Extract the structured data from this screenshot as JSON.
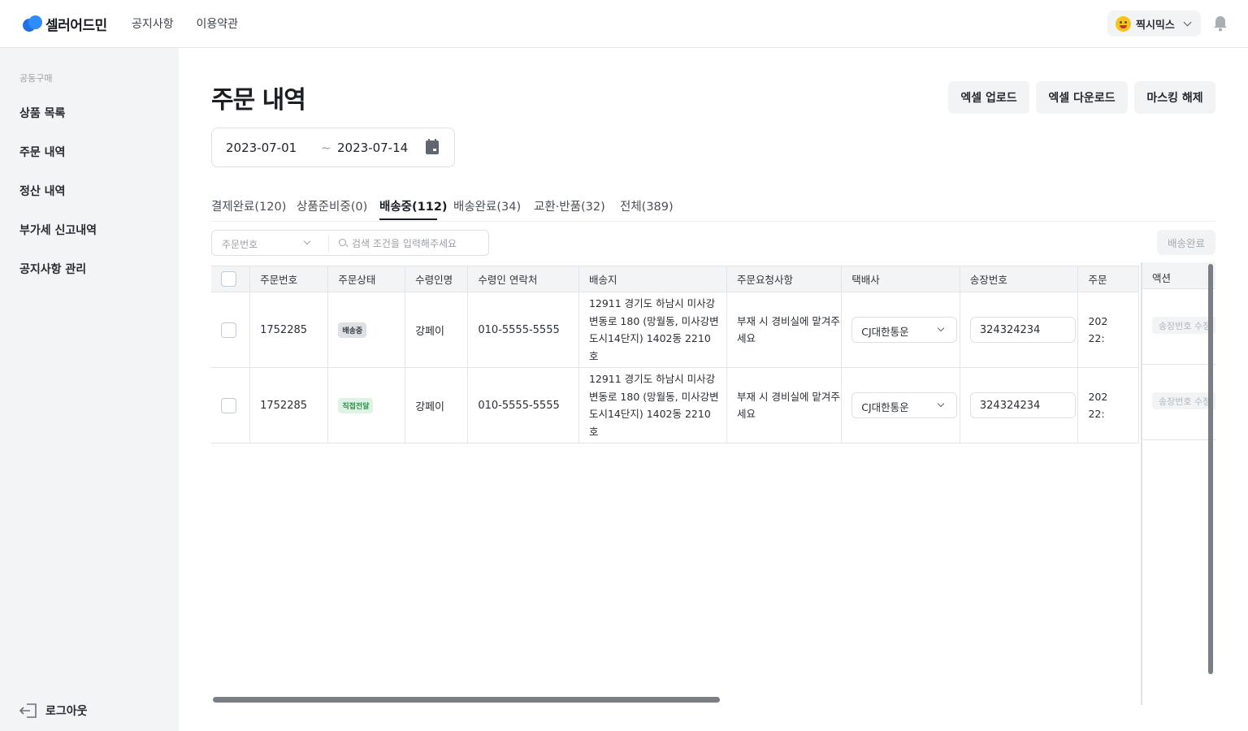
{
  "header": {
    "app_name": "셀러어드민",
    "nav": [
      "공지사항",
      "이용약관"
    ],
    "user_name": "찍시믹스"
  },
  "sidebar": {
    "category": "공동구매",
    "items": [
      {
        "label": "상품 목록"
      },
      {
        "label": "주문 내역"
      },
      {
        "label": "정산 내역"
      },
      {
        "label": "부가세 신고내역"
      },
      {
        "label": "공지사항 관리"
      }
    ],
    "logout_label": "로그아웃"
  },
  "main": {
    "title": "주문 내역",
    "buttons": {
      "excel_upload": "엑셀 업로드",
      "excel_download": "엑셀 다운로드",
      "unmask": "마스킹 해제"
    },
    "date_range": {
      "start": "2023-07-01",
      "separator": "~",
      "end": "2023-07-14"
    },
    "tabs": [
      {
        "label": "결제완료(120)"
      },
      {
        "label": "상품준비중(0)"
      },
      {
        "label": "배송중(112)",
        "active": true
      },
      {
        "label": "배송완료(34)"
      },
      {
        "label": "교환·반품(32)"
      },
      {
        "label": "전체(389)"
      }
    ],
    "filter": {
      "select_value": "주문번호",
      "search_placeholder": "검색 조건을 입력해주세요"
    },
    "bulk_action_label": "배송완료",
    "table": {
      "headers": [
        "주문번호",
        "주문상태",
        "수령인명",
        "수령인 연락처",
        "배송지",
        "주문요청사항",
        "택배사",
        "송장번호",
        "주문"
      ],
      "rows": [
        {
          "order_no": "1752285",
          "status": "배송중",
          "status_color": "#dde0e4",
          "recipient": "강페이",
          "phone": "010-5555-5555",
          "address": "12911 경기도 하남시 미사강변동로 180 (망월동, 미사강변도시14단지) 1402동 2210호",
          "request": "부재 시 경비실에 맡겨주세요",
          "carrier": "CJ대한통운",
          "tracking": "324324234",
          "date_line1": "202",
          "date_line2": "22:"
        },
        {
          "order_no": "1752285",
          "status": "직접전달",
          "status_color": "#dff3e4",
          "recipient": "강페이",
          "phone": "010-5555-5555",
          "address": "12911 경기도 하남시 미사강변동로 180 (망월동, 미사강변도시14단지) 1402동 2210호",
          "request": "부재 시 경비실에 맡겨주세요",
          "carrier": "CJ대한통운",
          "tracking": "324324234",
          "date_line1": "202",
          "date_line2": "22:"
        }
      ]
    },
    "action_column": {
      "header": "액션",
      "edit_label": "송장번호 수정"
    }
  }
}
